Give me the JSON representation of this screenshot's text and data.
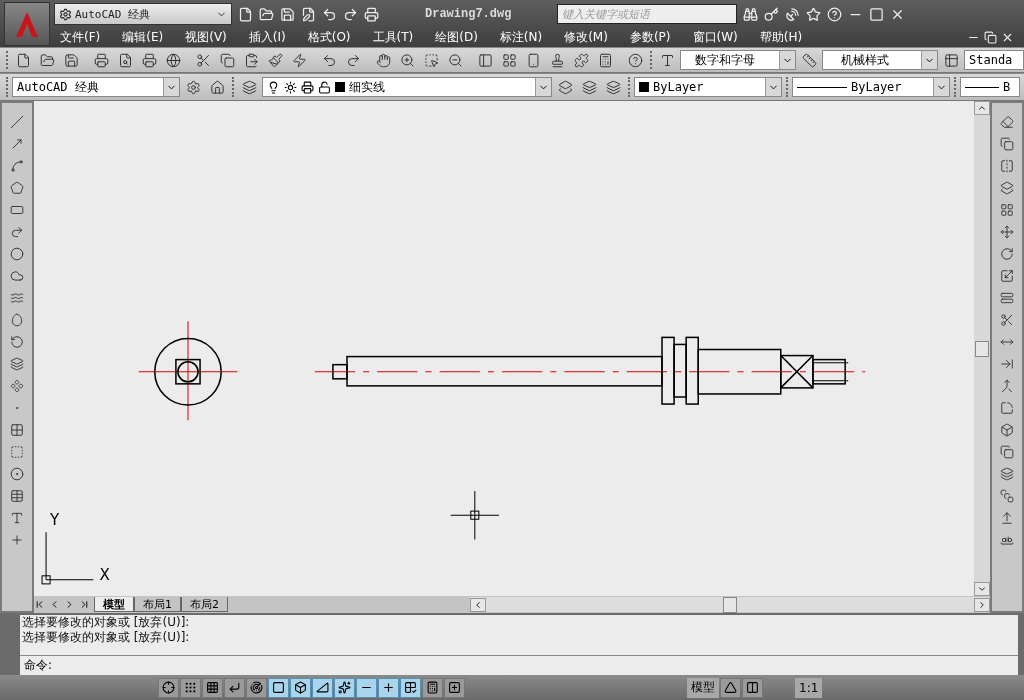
{
  "title_bar": {
    "workspace": "AutoCAD 经典",
    "title": "Drawing7.dwg",
    "search": {
      "placeholder": "键入关键字或短语"
    }
  },
  "menu_bar": [
    "文件(F)",
    "编辑(E)",
    "视图(V)",
    "插入(I)",
    "格式(O)",
    "工具(T)",
    "绘图(D)",
    "标注(N)",
    "修改(M)",
    "参数(P)",
    "窗口(W)",
    "帮助(H)"
  ],
  "toolbar_1": {
    "text_style": "数字和字母",
    "dim_style": "机械样式",
    "table_style": "Standa"
  },
  "toolbar_2": {
    "workspace": "AutoCAD 经典",
    "layer": "细实线",
    "color_control": "ByLayer",
    "linetype": "ByLayer",
    "lineweight": "B"
  },
  "canvas": {
    "ucs": {
      "y_label": "Y",
      "x_label": "X"
    }
  },
  "layout_tabs": [
    {
      "label": "模型",
      "selected": true
    },
    {
      "label": "布局1",
      "selected": false
    },
    {
      "label": "布局2",
      "selected": false
    }
  ],
  "command_history": [
    "选择要修改的对象或 [放弃(U)]:",
    "选择要修改的对象或 [放弃(U)]:"
  ],
  "command_prompt": "命令:",
  "status_bar": {
    "toggles": [
      {
        "on": false
      },
      {
        "on": false
      },
      {
        "on": false
      },
      {
        "on": false
      },
      {
        "on": false
      },
      {
        "on": true
      },
      {
        "on": true
      },
      {
        "on": true
      },
      {
        "on": true
      },
      {
        "on": true
      },
      {
        "on": true
      },
      {
        "on": true
      },
      {
        "on": false
      },
      {
        "on": false
      }
    ],
    "space": "模型",
    "annotation_scale": "1:1"
  }
}
